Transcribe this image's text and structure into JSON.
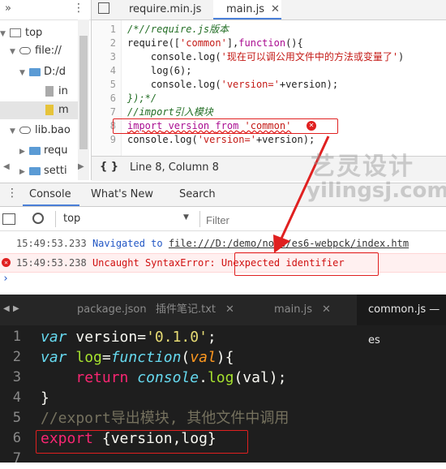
{
  "navigator": {
    "tree": [
      {
        "label": "top",
        "kind": "frame"
      },
      {
        "label": "file://",
        "kind": "cloud"
      },
      {
        "label": "D:/d",
        "kind": "folder"
      },
      {
        "label": "in",
        "kind": "file-gray"
      },
      {
        "label": "m",
        "kind": "file-yellow"
      },
      {
        "label": "lib.bao",
        "kind": "cloud"
      },
      {
        "label": "requ",
        "kind": "folder"
      },
      {
        "label": "setti",
        "kind": "folder"
      }
    ]
  },
  "editor_tabs": [
    {
      "label": "require.min.js",
      "active": false
    },
    {
      "label": "main.js",
      "active": true
    }
  ],
  "code_lines": [
    {
      "n": "1",
      "text": "/*//require.js版本"
    },
    {
      "n": "2",
      "text": "require(['common'],function(){"
    },
    {
      "n": "3",
      "text": "    console.log('现在可以调公用文件中的方法或变量了')"
    },
    {
      "n": "4",
      "text": "    log(6);"
    },
    {
      "n": "5",
      "text": "    console.log('version='+version);"
    },
    {
      "n": "6",
      "text": "});*/"
    },
    {
      "n": "7",
      "text": "//import引入模块"
    },
    {
      "n": "8",
      "text": "import version from 'common'"
    },
    {
      "n": "9",
      "text": "console.log('version='+version);"
    }
  ],
  "status": {
    "cursor": "Line 8, Column 8",
    "braces": "{ }"
  },
  "drawer_tabs": [
    "Console",
    "What's New",
    "Search"
  ],
  "console_toolbar": {
    "context": "top",
    "filter_placeholder": "Filter"
  },
  "console_messages": [
    {
      "time": "15:49:53.233",
      "prefix": "Navigated to",
      "text": "file:///D:/demo/node/es6-webpck/index.htm",
      "level": "info"
    },
    {
      "time": "15:49:53.238",
      "prefix": "Uncaught SyntaxError:",
      "text": "Unexpected identifier",
      "level": "error"
    }
  ],
  "dark_tabs": [
    {
      "label": "package.json",
      "active": false
    },
    {
      "label": "插件笔记.txt",
      "active": false
    },
    {
      "label": "main.js",
      "active": false
    },
    {
      "label": "common.js — es",
      "active": true
    }
  ],
  "dark_lines": [
    {
      "n": "1",
      "text": "var version='0.1.0';"
    },
    {
      "n": "2",
      "text": "var log=function(val){"
    },
    {
      "n": "3",
      "text": "    return console.log(val);"
    },
    {
      "n": "4",
      "text": "}"
    },
    {
      "n": "5",
      "text": "//export导出模块, 其他文件中调用"
    },
    {
      "n": "6",
      "text": "export {version,log}"
    },
    {
      "n": "7",
      "text": ""
    }
  ],
  "watermark": {
    "cn": "艺灵设计",
    "en": "yilingsj.com"
  },
  "colors": {
    "error": "#e02020",
    "accent": "#4a7fd8"
  }
}
